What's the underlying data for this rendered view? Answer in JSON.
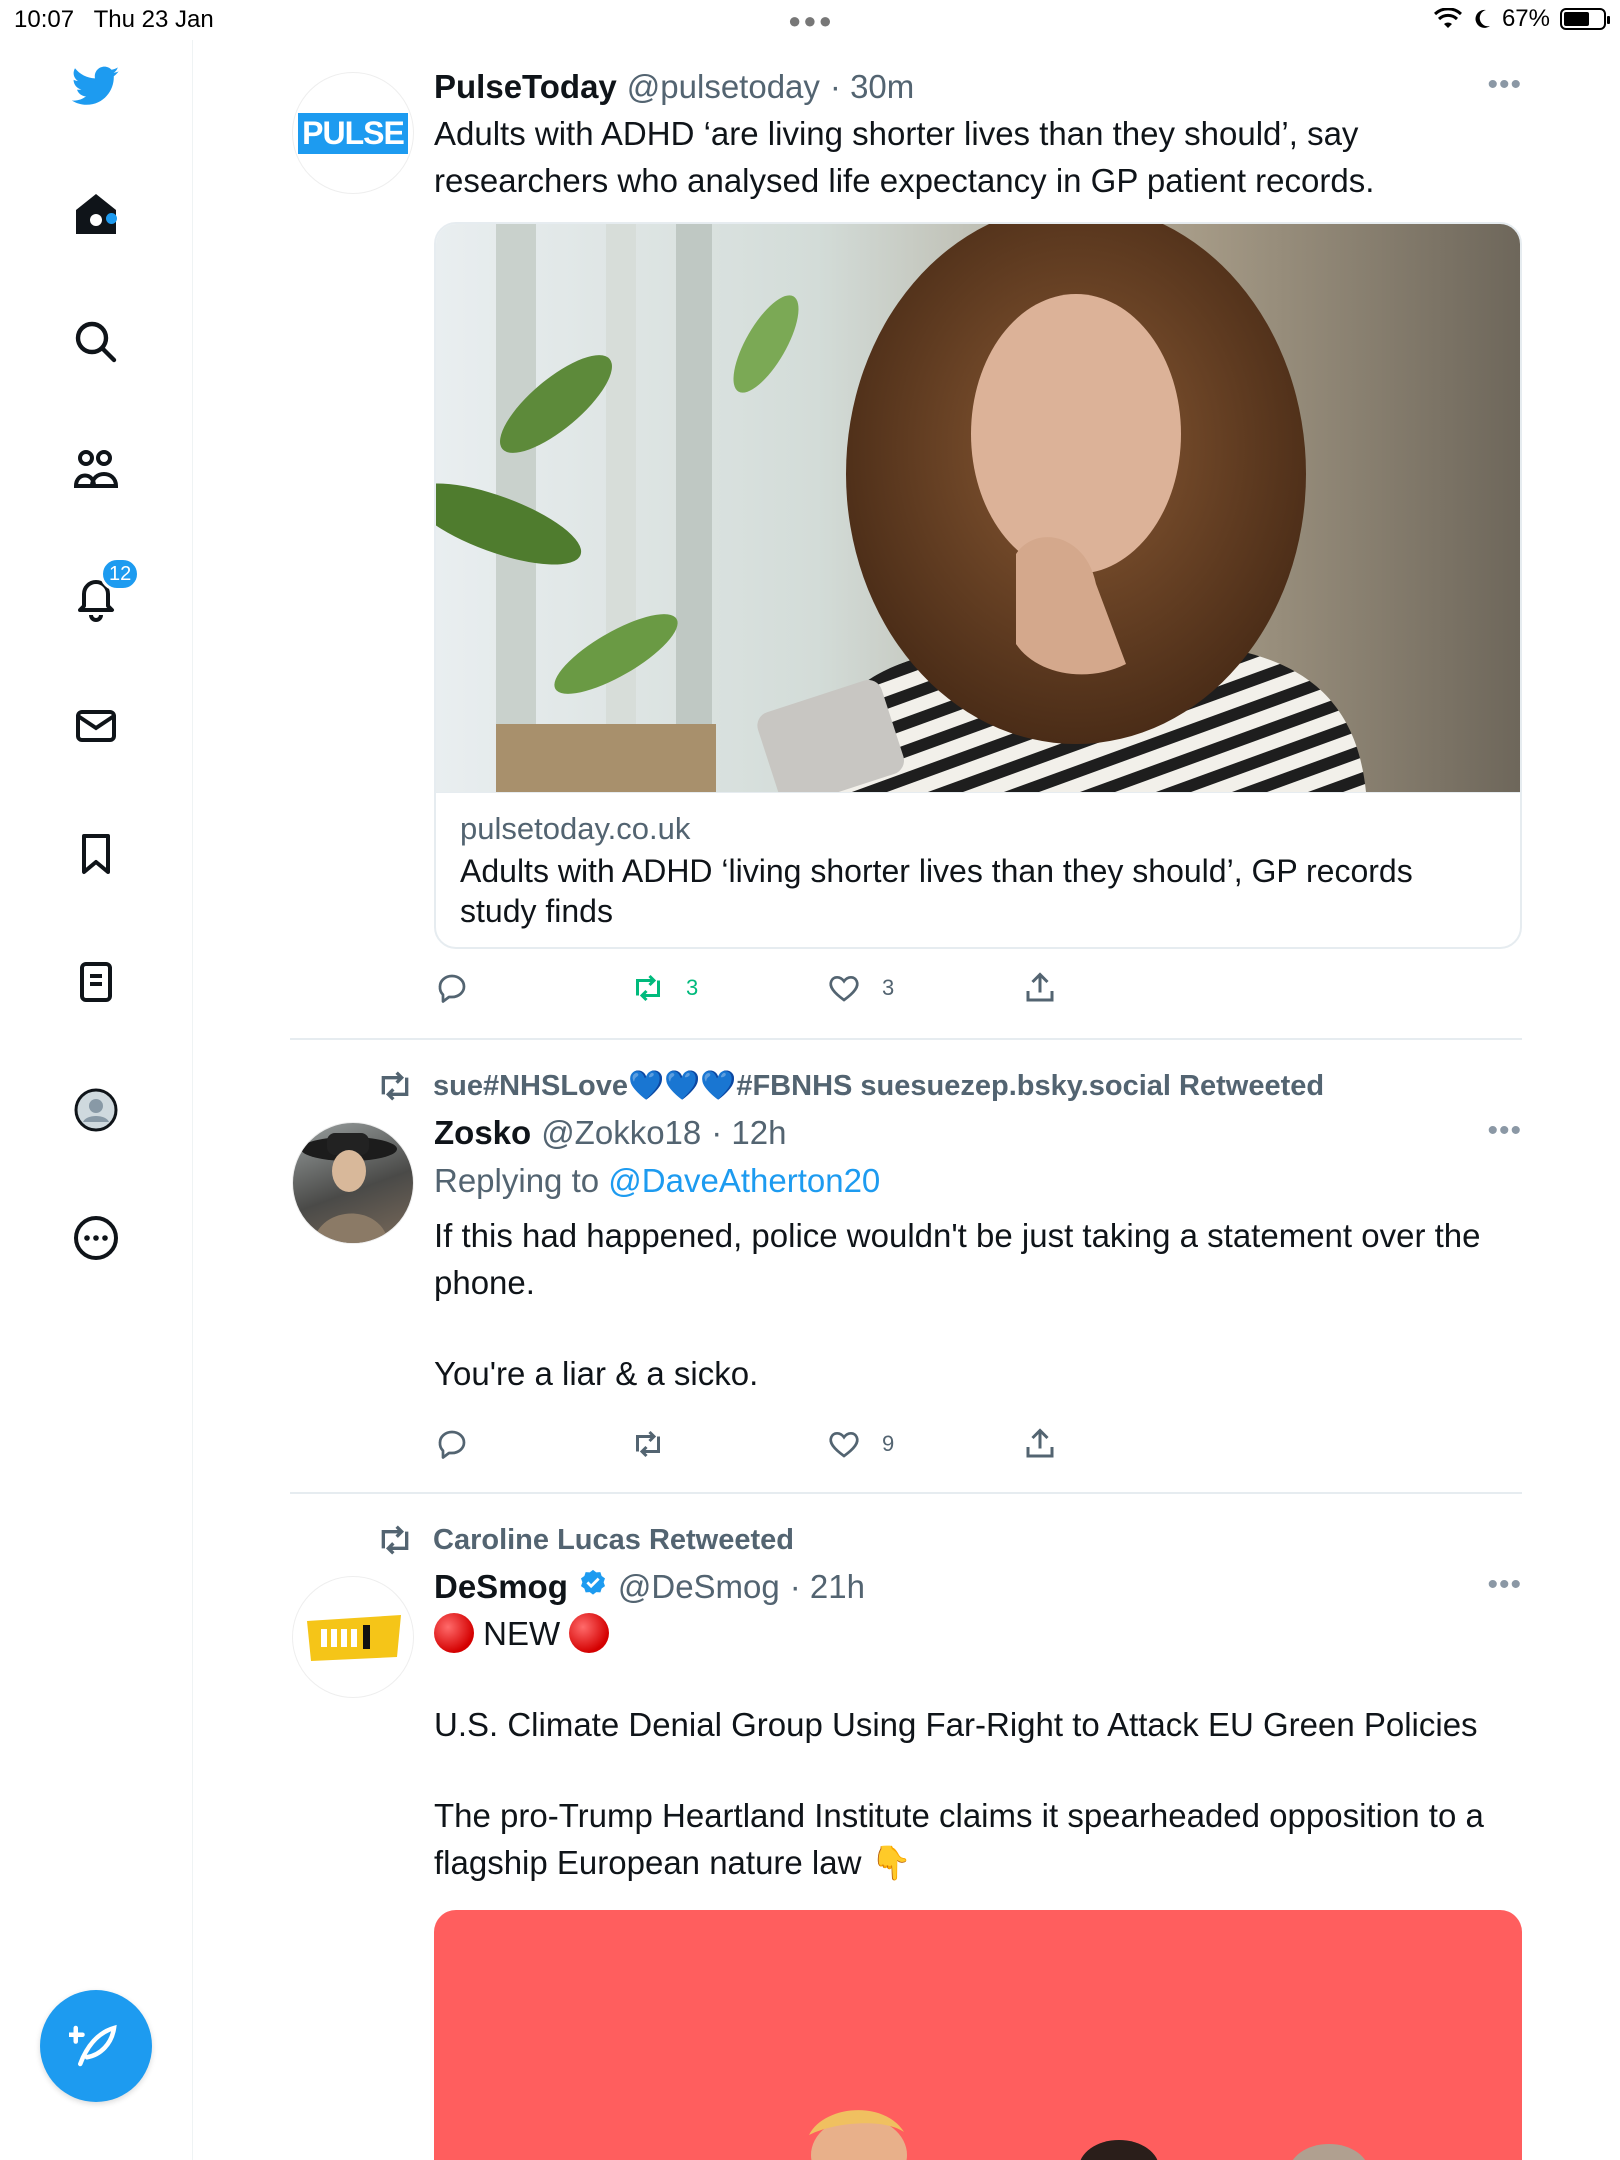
{
  "status_bar": {
    "time": "10:07",
    "date": "Thu 23 Jan",
    "battery": "67%",
    "battery_level": 0.67
  },
  "sidebar": {
    "items": [
      {
        "icon": "twitter-logo-icon"
      },
      {
        "icon": "home-icon"
      },
      {
        "icon": "search-icon"
      },
      {
        "icon": "communities-icon"
      },
      {
        "icon": "notifications-icon",
        "badge": "12"
      },
      {
        "icon": "messages-icon"
      },
      {
        "icon": "bookmarks-icon"
      },
      {
        "icon": "lists-icon"
      },
      {
        "icon": "profile-icon"
      },
      {
        "icon": "more-icon"
      }
    ],
    "compose_icon": "compose-feather-icon"
  },
  "colors": {
    "accent": "#1d9bf0",
    "retweet_active": "#00ba7c",
    "secondary_text": "#536471",
    "red_card": "#ff5e5e"
  },
  "tweets": [
    {
      "name": "PulseToday",
      "handle": "@pulsetoday",
      "time": "· 30m",
      "avatar_text": "PULSE",
      "text": "Adults with ADHD ‘are living shorter lives than they should’, say researchers who analysed life expectancy in GP patient records.",
      "card": {
        "domain": "pulsetoday.co.uk",
        "title": "Adults with ADHD ‘living shorter lives than they should’, GP records study finds"
      },
      "retweets": "3",
      "likes": "3"
    },
    {
      "retweeted_by": "sue#NHSLove💙💙💙#FBNHS suesuezep.bsky.social Retweeted",
      "name": "Zosko",
      "handle": "@Zokko18",
      "time": "· 12h",
      "replying_label": "Replying to",
      "replying_to": "@DaveAtherton20",
      "text1": "If this had happened, police wouldn't be just taking a statement over the phone.",
      "text2": "You're a liar & a sicko.",
      "likes": "9"
    },
    {
      "retweeted_by": "Caroline Lucas Retweeted",
      "name": "DeSmog",
      "handle": "@DeSmog",
      "time": "· 21h",
      "new_label": "NEW",
      "line1": "U.S. Climate Denial Group Using Far-Right to Attack EU Green Policies",
      "line2": "The pro-Trump Heartland Institute claims it spearheaded opposition to a flagship European nature law 👇"
    }
  ]
}
